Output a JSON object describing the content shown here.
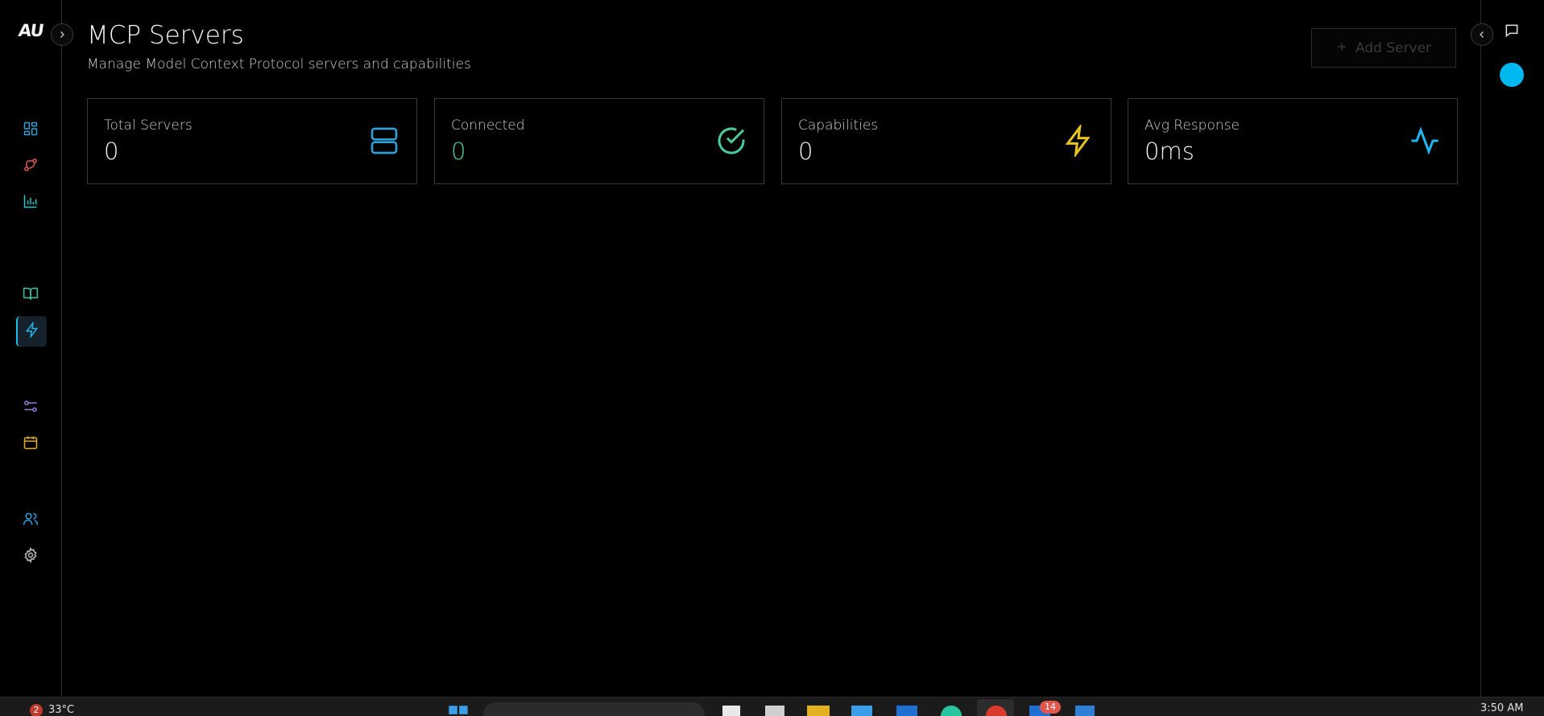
{
  "app": {
    "logo_text": "AU"
  },
  "sidebar": {
    "items": [
      {
        "icon": "grid-icon",
        "color": "#2f9fd6"
      },
      {
        "icon": "git-branch-icon",
        "color": "#e0574f"
      },
      {
        "icon": "bar-chart-icon",
        "color": "#2fc6c6"
      },
      {
        "icon": "book-open-icon",
        "color": "#2fc6a4"
      },
      {
        "icon": "zap-icon",
        "color": "#22b8e8",
        "active": true
      },
      {
        "icon": "sliders-icon",
        "color": "#8f7fe0"
      },
      {
        "icon": "calendar-icon",
        "color": "#e3b021"
      },
      {
        "icon": "users-icon",
        "color": "#2fa0e0"
      },
      {
        "icon": "settings-icon",
        "color": "#bfbfbf"
      }
    ]
  },
  "header": {
    "title": "MCP Servers",
    "subtitle": "Manage Model Context Protocol servers and capabilities",
    "add_button_label": "Add Server"
  },
  "stats": [
    {
      "label": "Total Servers",
      "value": "0",
      "icon": "server-icon",
      "color": "#2f9fd6",
      "value_color": "#f2f2f2"
    },
    {
      "label": "Connected",
      "value": "0",
      "icon": "check-circle-icon",
      "color": "#4cc9a0",
      "value_color": "#4cc9a0"
    },
    {
      "label": "Capabilities",
      "value": "0",
      "icon": "zap-icon",
      "color": "#e8c51c",
      "value_color": "#f2f2f2"
    },
    {
      "label": "Avg Response",
      "value": "0ms",
      "icon": "activity-icon",
      "color": "#1fb5ee",
      "value_color": "#f2f2f2"
    }
  ],
  "taskbar": {
    "weather_badge": "2",
    "temperature": "33°C",
    "notification_count": "14",
    "clock": "3:50 AM"
  }
}
